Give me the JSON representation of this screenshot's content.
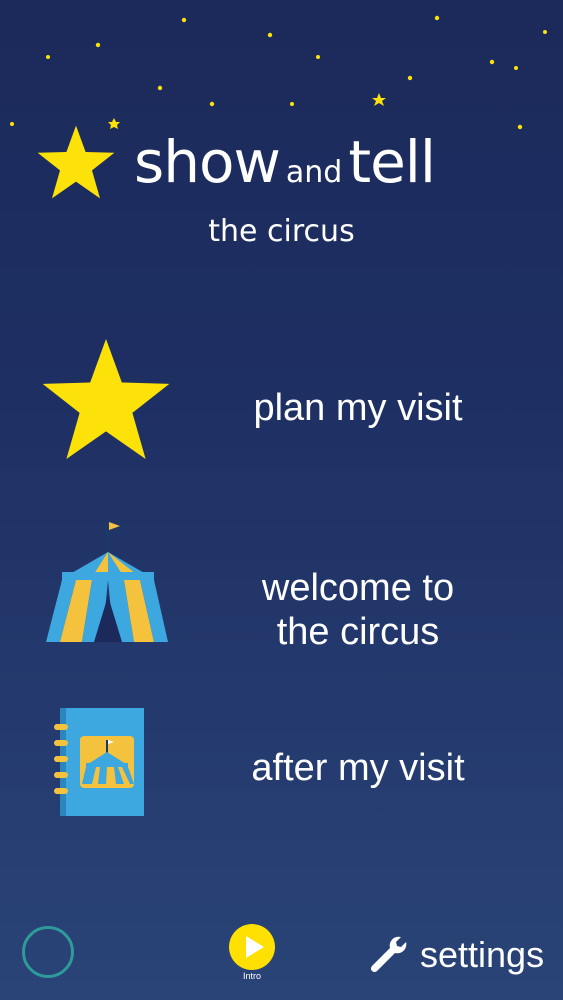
{
  "header": {
    "title_show": "show",
    "title_and": "and",
    "title_tell": "tell",
    "subtitle": "the circus"
  },
  "menu": [
    {
      "label": "plan my visit",
      "icon": "star-icon"
    },
    {
      "label": "welcome to the circus",
      "line1": "welcome to",
      "line2": "the circus",
      "icon": "circus-tent-icon"
    },
    {
      "label": "after my visit",
      "icon": "book-icon"
    }
  ],
  "footer": {
    "intro_label": "Intro",
    "settings_label": "settings"
  },
  "colors": {
    "star": "#fde20a",
    "background_top": "#1b2a5a",
    "background_bottom": "#2a4478",
    "tent_blue": "#3da7e0",
    "tent_yellow": "#f5c23d",
    "circle_ring": "#2e9a9a",
    "intro_yellow": "#ffe000"
  }
}
